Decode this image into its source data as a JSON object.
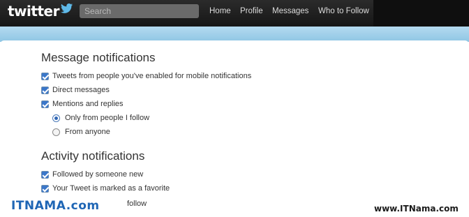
{
  "header": {
    "logo_text": "twitter",
    "search_placeholder": "Search",
    "nav": {
      "home": "Home",
      "profile": "Profile",
      "messages": "Messages",
      "who_to_follow": "Who to Follow"
    }
  },
  "message_notifications": {
    "heading": "Message notifications",
    "tweets_mobile": "Tweets from people you've enabled for mobile notifications",
    "direct_messages": "Direct messages",
    "mentions": "Mentions and replies",
    "only_following": "Only from people I follow",
    "from_anyone": "From anyone"
  },
  "activity_notifications": {
    "heading": "Activity notifications",
    "followed": "Followed by someone new",
    "favorite": "Your Tweet is marked as a favorite",
    "partial": "follow"
  },
  "watermark": {
    "left": "ITNAMA.com",
    "right": "www.ITNama.com"
  },
  "colors": {
    "topbar": "#1c1c1c",
    "blue_bar": "#9fcfea",
    "checkbox": "#3b77c9",
    "watermark": "#1f66b5"
  }
}
